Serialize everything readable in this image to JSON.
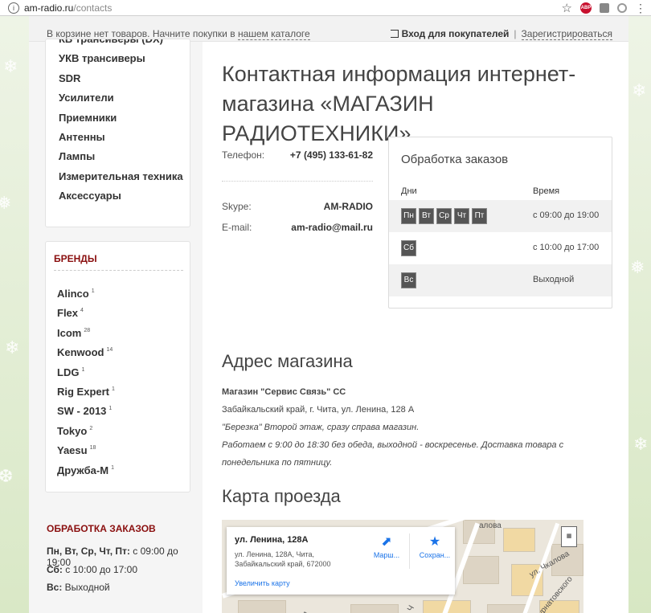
{
  "browser": {
    "url_host": "am-radio.ru",
    "url_path": "/contacts",
    "info_icon": "info-icon"
  },
  "topbar": {
    "cart_text": "В корзине нет товаров. Начните покупки в ",
    "cart_link": "нашем каталоге",
    "login": "Вход для покупателей",
    "separator": "|",
    "register": "Зарегистрироваться"
  },
  "sidebar": {
    "categories": [
      "КВ трансиверы (DX)",
      "УКВ трансиверы",
      "SDR",
      "Усилители",
      "Приемники",
      "Антенны",
      "Лампы",
      "Измерительная техника",
      "Аксессуары"
    ],
    "brands_title": "БРЕНДЫ",
    "brands": [
      {
        "name": "Alinco",
        "count": "1"
      },
      {
        "name": "Flex",
        "count": "4"
      },
      {
        "name": "Icom",
        "count": "28"
      },
      {
        "name": "Kenwood",
        "count": "14"
      },
      {
        "name": "LDG",
        "count": "1"
      },
      {
        "name": "Rig Expert",
        "count": "1"
      },
      {
        "name": "SW - 2013",
        "count": "1"
      },
      {
        "name": "Tokyo",
        "count": "2"
      },
      {
        "name": "Yaesu",
        "count": "18"
      },
      {
        "name": "Дружба-М",
        "count": "1"
      }
    ],
    "orders_title": "ОБРАБОТКА ЗАКАЗОВ",
    "orders_lines": [
      {
        "label": "Пн, Вт, Ср, Чт, Пт:",
        "value": " с 09:00 до 19:00"
      },
      {
        "label": "Сб:",
        "value": " с 10:00 до 17:00"
      },
      {
        "label": "Вс:",
        "value": " Выходной"
      }
    ]
  },
  "main": {
    "title": "Контактная информация интернет-магазина «МАГАЗИН РАДИОТЕХНИКИ»",
    "phone_label": "Телефон:",
    "phone_value": "+7 (495) 133-61-82",
    "skype_label": "Skype:",
    "skype_value": "AM-RADIO",
    "email_label": "E-mail:",
    "email_value": "am-radio@mail.ru",
    "hours": {
      "title": "Обработка заказов",
      "col_days": "Дни",
      "col_time": "Время",
      "rows": [
        {
          "days": [
            "Пн",
            "Вт",
            "Ср",
            "Чт",
            "Пт"
          ],
          "time": "с 09:00 до 19:00"
        },
        {
          "days": [
            "Сб"
          ],
          "time": "с 10:00 до 17:00"
        },
        {
          "days": [
            "Вс"
          ],
          "time": "Выходной"
        }
      ]
    },
    "address_title": "Адрес магазина",
    "shop_name": "Магазин \"Сервис Связь\" СС",
    "address_line": "Забайкальский край, г. Чита, ул. Ленина, 128 А",
    "address_note": "\"Березка\" Второй этаж, сразу справа магазин.",
    "work_note": "Работаем с 9:00 до 18:30 без обеда, выходной - воскресенье. Доставка товара с понедельника по пятницу.",
    "map_title": "Карта проезда",
    "map": {
      "place_name": "ул. Ленина, 128А",
      "place_address": "ул. Ленина, 128А, Чита, Забайкальский край, 672000",
      "route_label": "Марш...",
      "save_label": "Сохран...",
      "enlarge_label": "Увеличить карту",
      "street_labels": [
        "ул. Чкалова",
        "Курнатовского",
        "площадь Революции",
        "ул. Ч",
        "ул. Л",
        "алова"
      ]
    }
  }
}
